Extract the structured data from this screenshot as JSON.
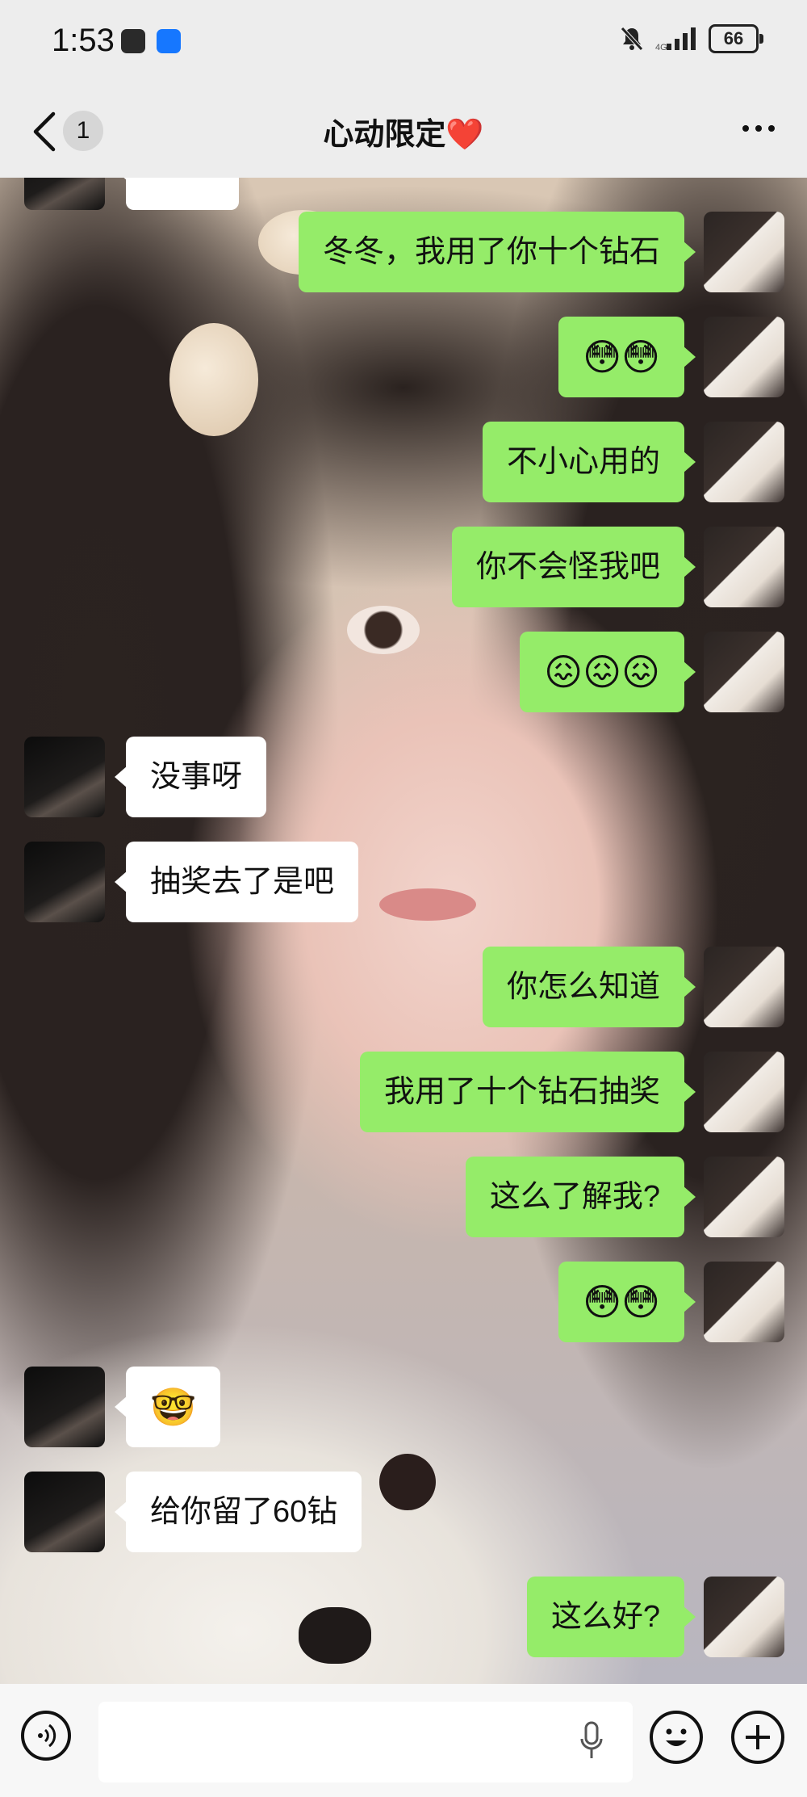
{
  "status_bar": {
    "time": "1:53",
    "battery": "66",
    "apps": [
      "soul-icon",
      "qq-browser-icon"
    ],
    "icons": [
      "mute-bell-icon",
      "signal-icon",
      "battery-icon"
    ]
  },
  "header": {
    "back_icon": "chevron-left-icon",
    "unread_count": "1",
    "title": "心动限定❤️",
    "more_icon": "more-dots-icon"
  },
  "messages": [
    {
      "sender": "me",
      "text": "冬冬，我用了你十个钻石"
    },
    {
      "sender": "me",
      "text": "😳😳"
    },
    {
      "sender": "me",
      "text": "不小心用的"
    },
    {
      "sender": "me",
      "text": "你不会怪我吧"
    },
    {
      "sender": "me",
      "text": "😖😖😖"
    },
    {
      "sender": "other",
      "text": "没事呀"
    },
    {
      "sender": "other",
      "text": "抽奖去了是吧"
    },
    {
      "sender": "me",
      "text": "你怎么知道"
    },
    {
      "sender": "me",
      "text": "我用了十个钻石抽奖"
    },
    {
      "sender": "me",
      "text": "这么了解我?"
    },
    {
      "sender": "me",
      "text": "😳😳"
    },
    {
      "sender": "other",
      "text": "🤓"
    },
    {
      "sender": "other",
      "text": "给你留了60钻"
    },
    {
      "sender": "me",
      "text": "这么好?"
    }
  ],
  "input_bar": {
    "voice_icon": "voice-icon",
    "placeholder": "",
    "mic_icon": "microphone-icon",
    "emoji_icon": "emoji-icon",
    "plus_icon": "plus-icon"
  },
  "colors": {
    "my_bubble": "#95ec69",
    "other_bubble": "#ffffff",
    "bar_background": "#ededed"
  }
}
